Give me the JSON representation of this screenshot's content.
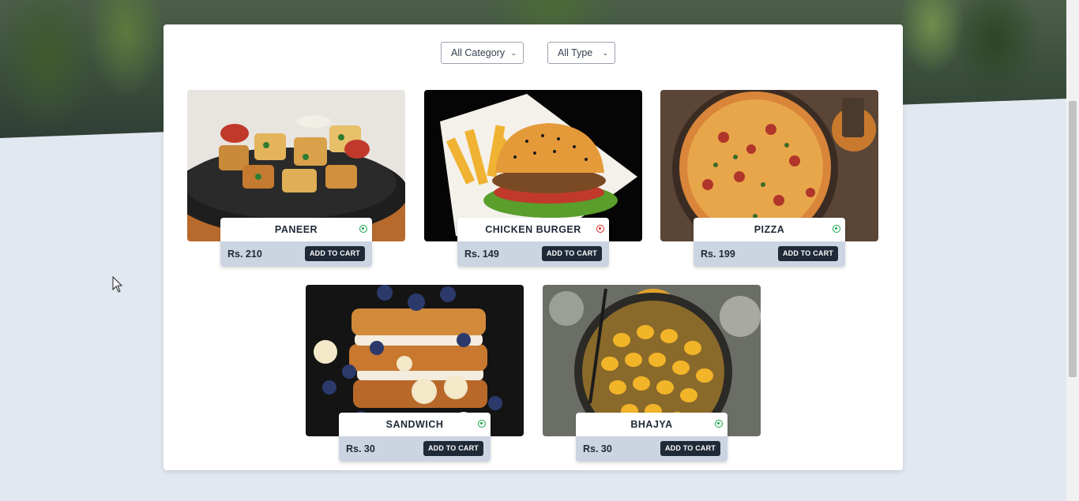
{
  "filters": {
    "category": {
      "selected": "All Category"
    },
    "type": {
      "selected": "All Type"
    }
  },
  "products": [
    {
      "name": "PANEER",
      "price": "Rs. 210",
      "button": "ADD TO CART",
      "diet": "veg",
      "diet_color": "#16a34a",
      "image": "paneer-tikka-sizzler"
    },
    {
      "name": "CHICKEN BURGER",
      "price": "Rs. 149",
      "button": "ADD TO CART",
      "diet": "non-veg",
      "diet_color": "#dc2626",
      "image": "burger-with-fries"
    },
    {
      "name": "PIZZA",
      "price": "Rs. 199",
      "button": "ADD TO CART",
      "diet": "veg",
      "diet_color": "#16a34a",
      "image": "pizza"
    },
    {
      "name": "SANDWICH",
      "price": "Rs. 30",
      "button": "ADD TO CART",
      "diet": "veg",
      "diet_color": "#16a34a",
      "image": "french-toast-sandwich"
    },
    {
      "name": "BHAJYA",
      "price": "Rs. 30",
      "button": "ADD TO CART",
      "diet": "veg",
      "diet_color": "#16a34a",
      "image": "bhajiya-frying"
    }
  ],
  "colors": {
    "page_background": "#e2e8f0",
    "button": "#1f2937",
    "price_bar": "#cbd5e1"
  }
}
